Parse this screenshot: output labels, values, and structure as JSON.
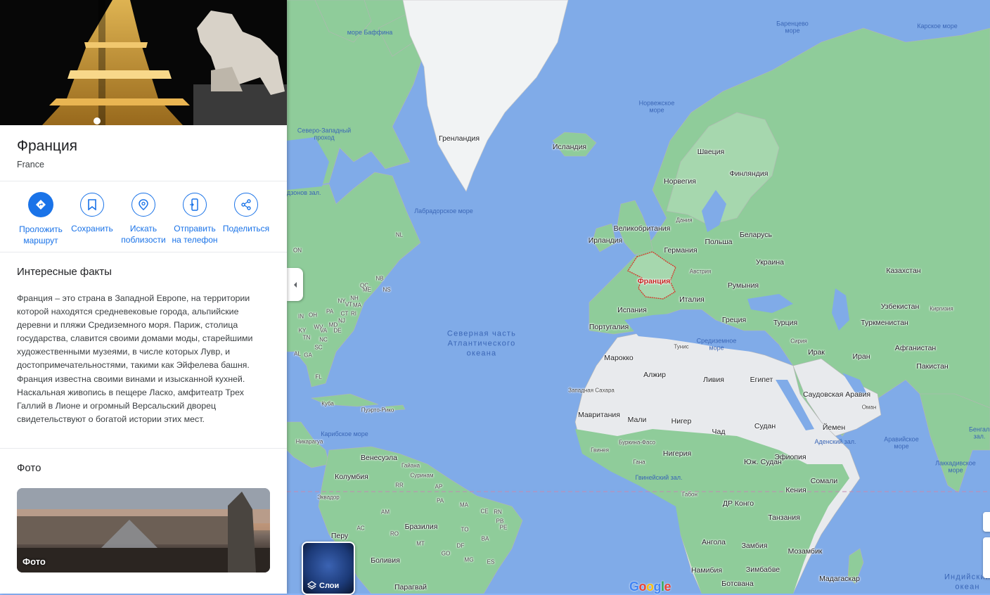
{
  "panel": {
    "title": "Франция",
    "subtitle": "France",
    "actions": [
      {
        "label": "Проложить маршрут",
        "icon": "directions-icon"
      },
      {
        "label": "Сохранить",
        "icon": "bookmark-icon"
      },
      {
        "label": "Искать поблизости",
        "icon": "nearby-search-icon"
      },
      {
        "label": "Отправить на телефон",
        "icon": "send-to-phone-icon"
      },
      {
        "label": "Поделиться",
        "icon": "share-icon"
      }
    ],
    "facts_heading": "Интересные факты",
    "facts_text": "Франция – это страна в Западной Европе, на территории которой находятся средневековые города, альпийские деревни и пляжи Средиземного моря. Париж, столица государства, славится своими домами моды, старейшими художественными музеями, в числе которых Лувр, и достопримечательностями, такими как Эйфелева башня. Франция известна своими винами и изысканной кухней. Наскальная живопись в пещере Ласко, амфитеатр Трех Галлий в Лионе и огромный Версальский дворец свидетельствуют о богатой истории этих мест.",
    "photos_heading": "Фото",
    "photo_label": "Фото"
  },
  "map": {
    "highlighted_country": "Франция",
    "layers_label": "Слои",
    "logo": "Google",
    "countries": [
      "Гренландия",
      "Исландия",
      "Швеция",
      "Финляндия",
      "Норвегия",
      "Дания",
      "Великобритания",
      "Ирландия",
      "Германия",
      "Польша",
      "Беларусь",
      "Австрия",
      "Украина",
      "Румыния",
      "Италия",
      "Испания",
      "Португалия",
      "Греция",
      "Турция",
      "Казахстан",
      "Узбекистан",
      "Киргизия",
      "Туркменистан",
      "Тунис",
      "Марокко",
      "Алжир",
      "Ливия",
      "Египет",
      "Сирия",
      "Ирак",
      "Иран",
      "Афганистан",
      "Пакистан",
      "Саудовская Аравия",
      "Оман",
      "Йемен",
      "Западная Сахара",
      "Мавритания",
      "Мали",
      "Нигер",
      "Чад",
      "Судан",
      "Буркина-Фасо",
      "Гвинея",
      "Гана",
      "Нигерия",
      "Эфиопия",
      "Юж. Судан",
      "Габон",
      "ДР Конго",
      "Кения",
      "Сомали",
      "Танзания",
      "Ангола",
      "Замбия",
      "Мозамбик",
      "Намибия",
      "Зимбабве",
      "Ботсвана",
      "Мадагаскар",
      "Венесуэла",
      "Гайана",
      "Суринам",
      "Колумбия",
      "Эквадор",
      "Перу",
      "Бразилия",
      "Боливия",
      "Парагвай",
      "Куба",
      "Пуэрто-Рико",
      "Никарагуа"
    ],
    "small_labels": [
      "NL",
      "ON",
      "QC",
      "NB",
      "NS",
      "ME",
      "NH",
      "VT",
      "MA",
      "NY",
      "CT",
      "RI",
      "PA",
      "NJ",
      "MD",
      "DE",
      "IN",
      "OH",
      "WV",
      "VA",
      "KY",
      "TN",
      "NC",
      "SC",
      "AL",
      "GA",
      "FL",
      "RR",
      "AP",
      "PA",
      "AM",
      "MA",
      "CE",
      "RN",
      "PB",
      "PE",
      "AC",
      "RO",
      "MT",
      "TO",
      "BA",
      "DF",
      "GO",
      "MG",
      "ES"
    ],
    "seas": [
      "море Баффина",
      "Баренцево море",
      "Карское море",
      "Норвежское море",
      "Северо-Западный проход",
      "Гудзонов зал.",
      "Лабрадорское море",
      "Средиземное море",
      "Карибское море",
      "Гвинейский зал.",
      "Аденский зал.",
      "Аравийское море",
      "Лаккадивское море",
      "Бенгальский зал."
    ],
    "oceans": [
      "Северная часть Атлантического океана",
      "Индийский океан"
    ]
  }
}
